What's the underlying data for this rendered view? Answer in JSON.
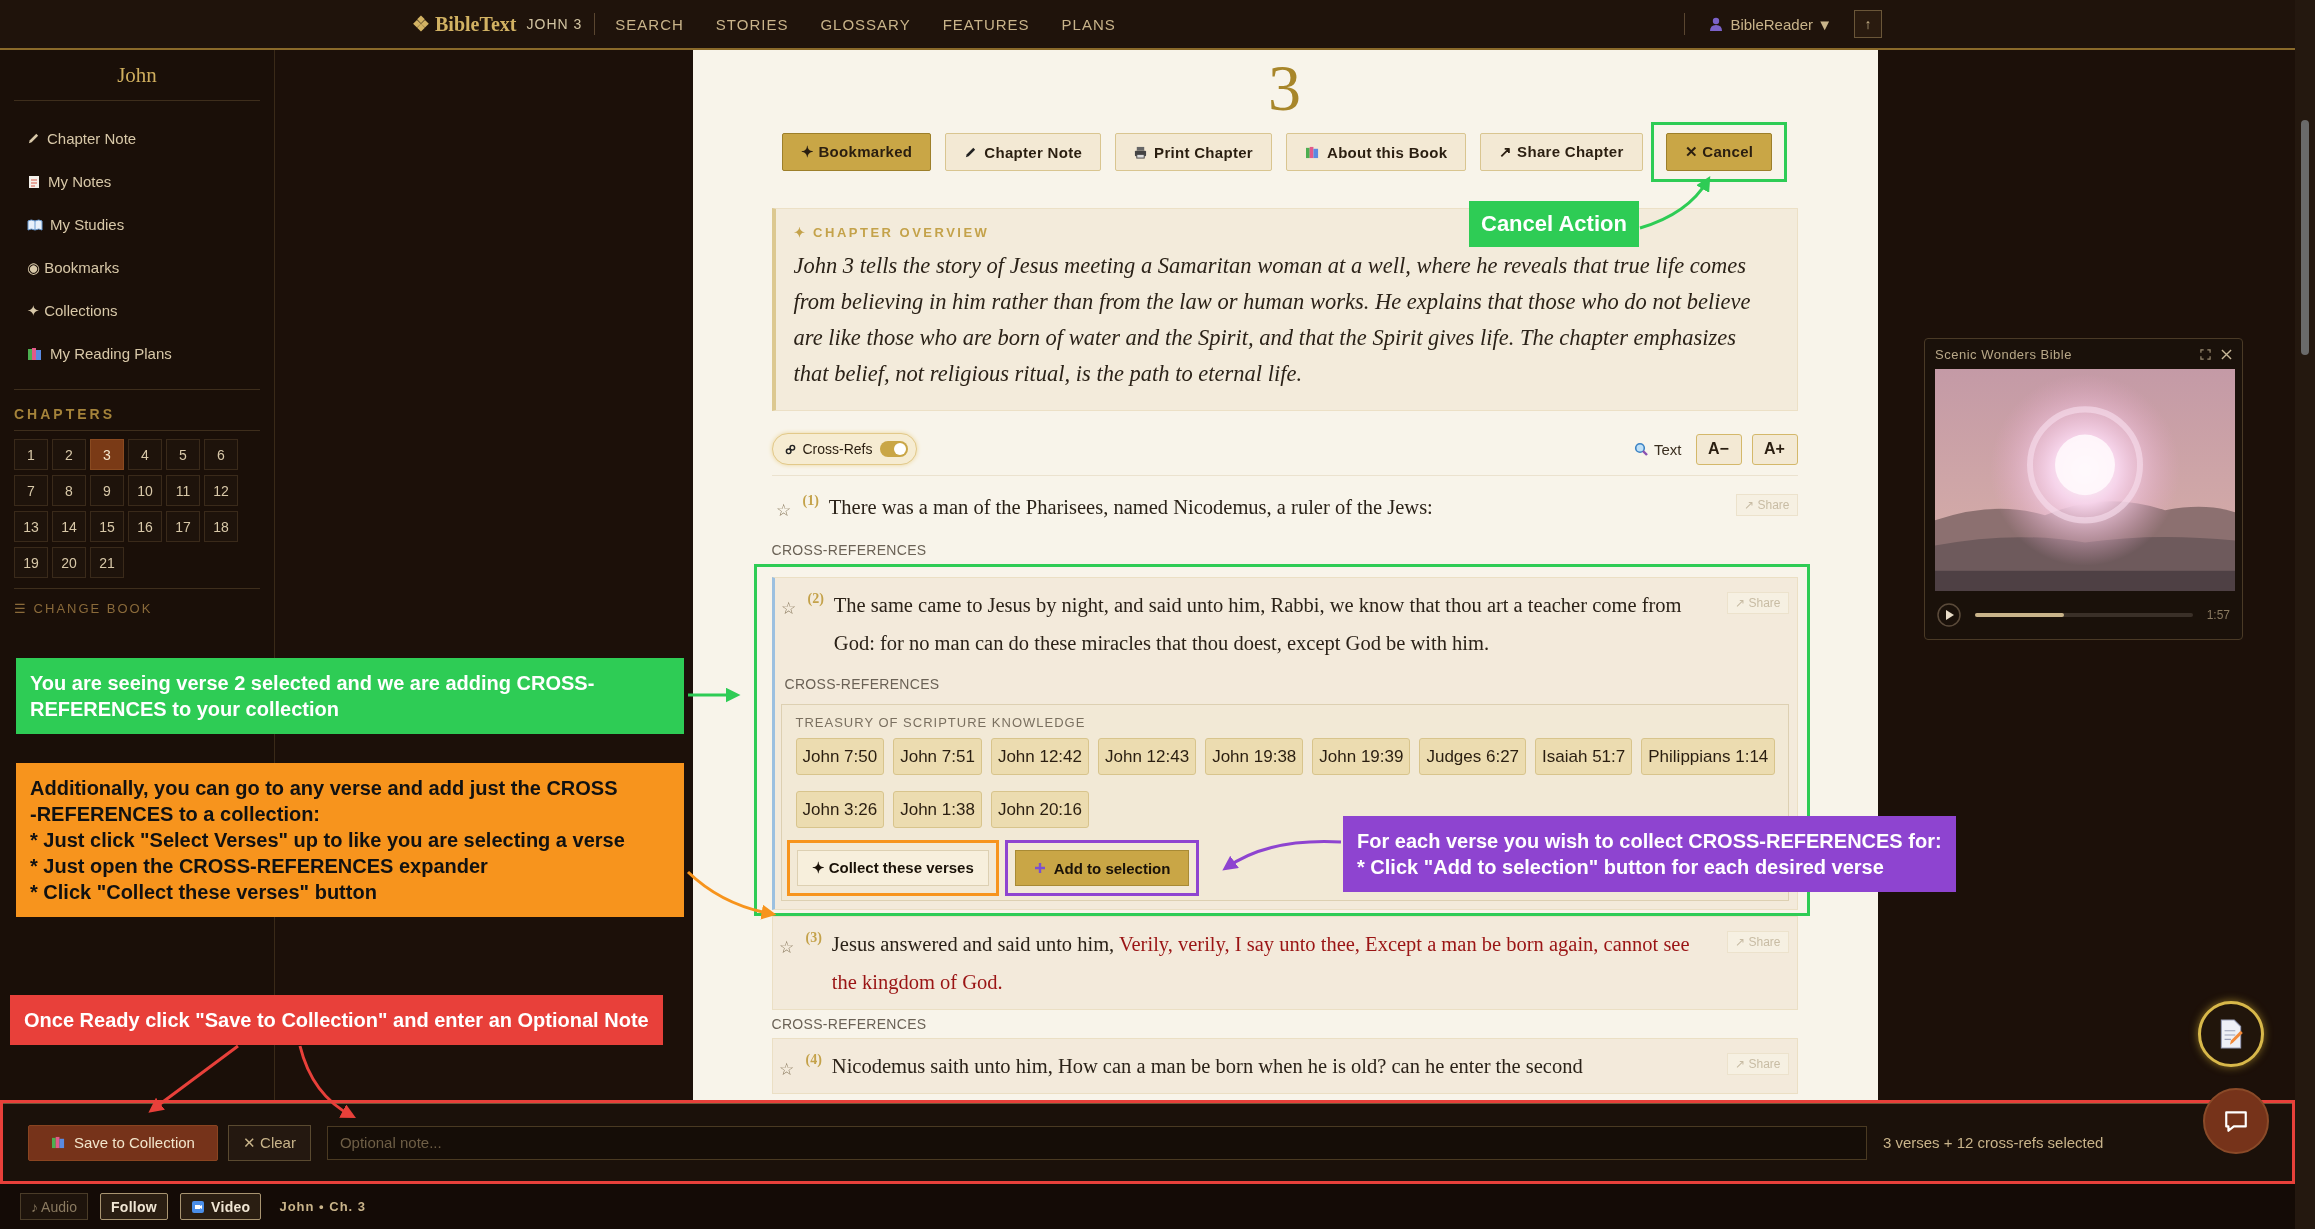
{
  "header": {
    "logo": "❖ BibleText",
    "location": "JOHN 3",
    "nav": [
      {
        "label": "SEARCH"
      },
      {
        "label": "STORIES"
      },
      {
        "label": "GLOSSARY"
      },
      {
        "label": "FEATURES"
      },
      {
        "label": "PLANS"
      }
    ],
    "user": "BibleReader ▼",
    "top_button": "↑"
  },
  "sidebar": {
    "book": "John",
    "items": [
      {
        "label": "Chapter Note"
      },
      {
        "label": "My Notes"
      },
      {
        "label": "My Studies"
      },
      {
        "label": "◉ Bookmarks"
      },
      {
        "label": "✦ Collections"
      },
      {
        "label": "My Reading Plans"
      }
    ],
    "chapters_heading": "CHAPTERS",
    "chapters": [
      {
        "label": "1",
        "selected": false
      },
      {
        "label": "2",
        "selected": false
      },
      {
        "label": "3",
        "selected": true
      },
      {
        "label": "4",
        "selected": false
      },
      {
        "label": "5",
        "selected": false
      },
      {
        "label": "6",
        "selected": false
      },
      {
        "label": "7",
        "selected": false
      },
      {
        "label": "8",
        "selected": false
      },
      {
        "label": "9",
        "selected": false
      },
      {
        "label": "10",
        "selected": false
      },
      {
        "label": "11",
        "selected": false
      },
      {
        "label": "12",
        "selected": false
      },
      {
        "label": "13",
        "selected": false
      },
      {
        "label": "14",
        "selected": false
      },
      {
        "label": "15",
        "selected": false
      },
      {
        "label": "16",
        "selected": false
      },
      {
        "label": "17",
        "selected": false
      },
      {
        "label": "18",
        "selected": false
      },
      {
        "label": "19",
        "selected": false
      },
      {
        "label": "20",
        "selected": false
      },
      {
        "label": "21",
        "selected": false
      }
    ],
    "change_book": "☰ CHANGE BOOK"
  },
  "chapter": {
    "number": "3",
    "actions": [
      {
        "label": "✦ Bookmarked",
        "kind": "primary"
      },
      {
        "label": "Chapter Note",
        "kind": "plain"
      },
      {
        "label": "Print Chapter",
        "kind": "plain"
      },
      {
        "label": "About this Book",
        "kind": "plain"
      },
      {
        "label": "↗ Share Chapter",
        "kind": "plain"
      },
      {
        "label": "✕ Cancel",
        "kind": "primary"
      }
    ]
  },
  "overview": {
    "heading": "✦ CHAPTER OVERVIEW",
    "text": "John 3 tells the story of Jesus meeting a Samaritan woman at a well, where he reveals that true life comes from believing in him rather than from the law or human works. He explains that those who do not believe are like those who are born of water and the Spirit, and that the Spirit gives life. The chapter emphasizes that belief, not religious ritual, is the path to eternal life."
  },
  "toolbar": {
    "cross_refs": {
      "label": "Cross-Refs",
      "on": true
    },
    "search_label": "Text",
    "font_buttons": [
      "A−",
      "A+"
    ]
  },
  "verses": [
    {
      "star": "☆",
      "number": "(1)",
      "parts": [
        {
          "text": "There was a man of the Pharisees, named Nicodemus, a ruler of the Jews:",
          "jesus_words": false
        }
      ],
      "share": "↗ Share",
      "selected": false,
      "expanded": false,
      "cross_refs_label": "CROSS-REFERENCES"
    },
    {
      "star": "☆",
      "number": "(2)",
      "parts": [
        {
          "text": "The same came to Jesus by night, and said unto him, Rabbi, we know that thou art a teacher come from God: for no man can do these miracles that thou doest, except God be with him.",
          "jesus_words": false
        }
      ],
      "share": "↗ Share",
      "selected": true,
      "expanded": true,
      "cross_refs_label": "CROSS-REFERENCES",
      "cross_refs": {
        "source": "TREASURY OF SCRIPTURE KNOWLEDGE",
        "refs": [
          "John 7:50",
          "John 7:51",
          "John 12:42",
          "John 12:43",
          "John 19:38",
          "John 19:39",
          "Judges 6:27",
          "Isaiah 51:7",
          "Philippians 1:14",
          "John 3:26",
          "John 1:38",
          "John 20:16"
        ],
        "collect": "✦ Collect these verses",
        "add": "Add to selection"
      }
    },
    {
      "star": "☆",
      "number": "(3)",
      "parts": [
        {
          "text": "Jesus answered and said unto him, ",
          "jesus_words": false
        },
        {
          "text": "Verily, verily, I say unto thee, Except a man be born again, cannot see the kingdom of God.",
          "jesus_words": true
        }
      ],
      "share": "↗ Share",
      "selected": true,
      "expanded": false,
      "cross_refs_label": "CROSS-REFERENCES"
    },
    {
      "star": "☆",
      "number": "(4)",
      "parts": [
        {
          "text": "Nicodemus saith unto him, How can a man be born when he is old? can he enter the second",
          "jesus_words": false
        }
      ],
      "share": "↗ Share",
      "selected": true,
      "expanded": false
    }
  ],
  "video": {
    "title": "Scenic Wonders Bible",
    "level": 0.41,
    "time": "1:57"
  },
  "collect_bar": {
    "save": "Save to Collection",
    "clear": "✕ Clear",
    "note_placeholder": "Optional note...",
    "summary": "3 verses + 12 cross-refs selected"
  },
  "footer": {
    "buttons": [
      {
        "label": "♪ Audio",
        "active": false
      },
      {
        "label": "Follow",
        "active": true
      },
      {
        "label": "Video",
        "active": true
      }
    ],
    "location": "John • Ch. 3"
  },
  "annotations": [
    {
      "color": "#2ecc55",
      "text": "Cancel Action"
    },
    {
      "color": "#2ecc55",
      "text": "You are seeing verse 2 selected and we are adding CROSS-REFERENCES to your collection"
    },
    {
      "color": "#f7941d",
      "text": "Additionally, you can go to any verse and add just the CROSS\n-REFERENCES to a collection:\n* Just click \"Select Verses\" up to like you are selecting a verse\n* Just open the CROSS-REFERENCES expander\n* Click  \"Collect these verses\" button"
    },
    {
      "color": "#8e44d0",
      "text": "For each verse you wish to collect CROSS-REFERENCES for:\n* Click \"Add to selection\" button for each desired verse"
    },
    {
      "color": "#e8403a",
      "text": "Once Ready click \"Save to Collection\" and enter an Optional Note"
    }
  ]
}
